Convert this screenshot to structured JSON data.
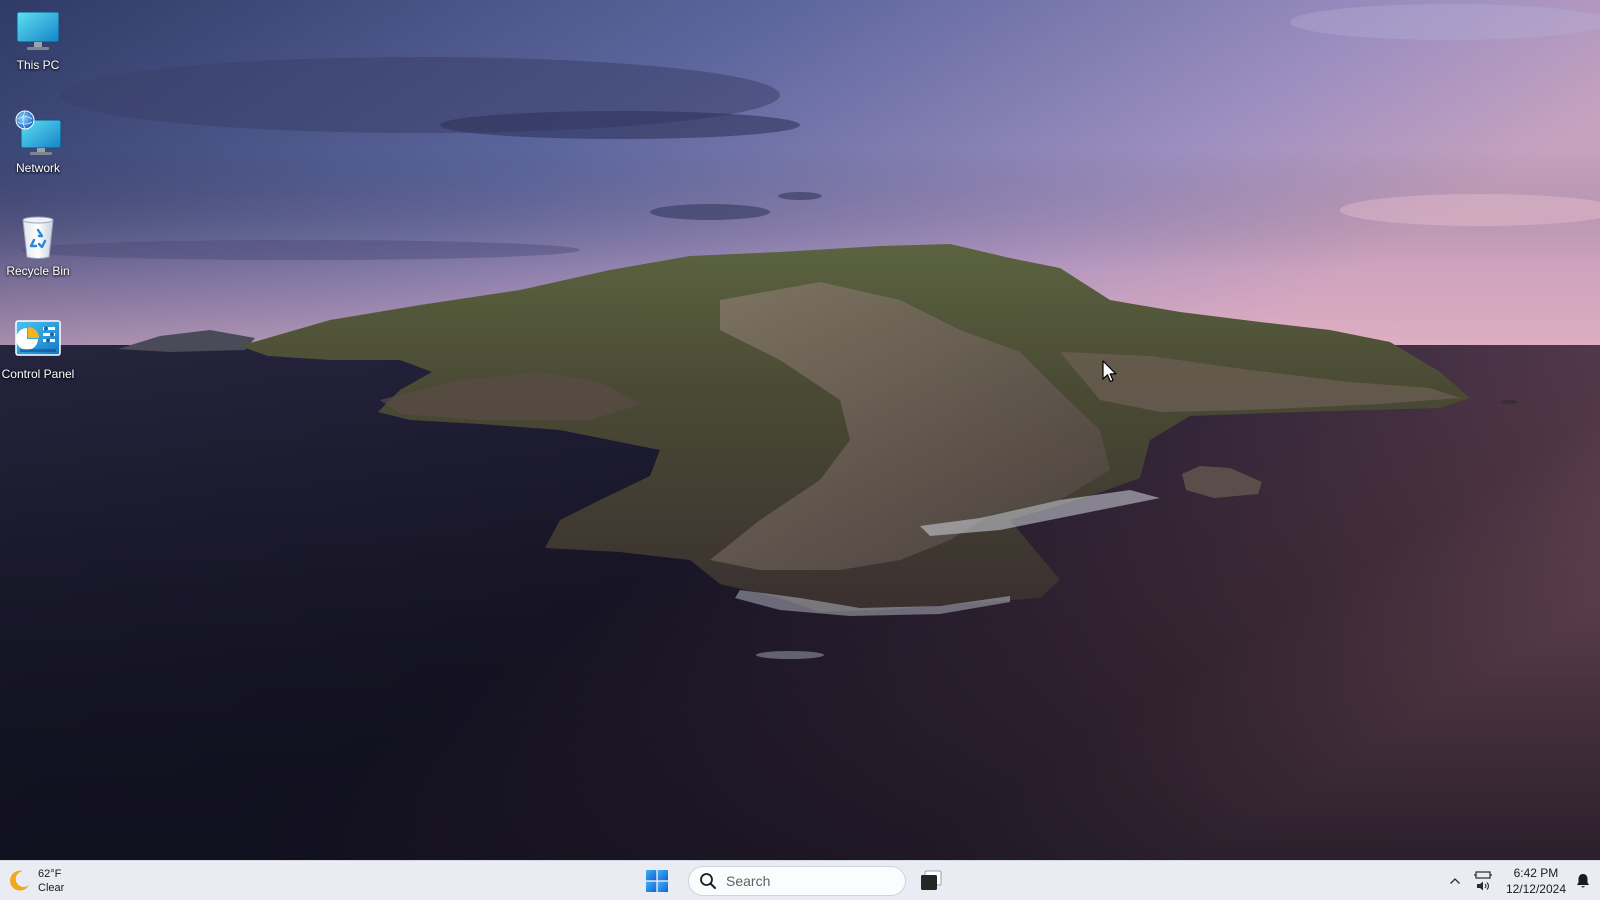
{
  "desktop": {
    "icons": [
      {
        "label": "This PC",
        "icon": "monitor-icon"
      },
      {
        "label": "Network",
        "icon": "network-globe-icon"
      },
      {
        "label": "Recycle Bin",
        "icon": "recycle-bin-icon"
      },
      {
        "label": "Control Panel",
        "icon": "control-panel-icon"
      }
    ]
  },
  "taskbar": {
    "weather": {
      "temperature": "62°F",
      "condition": "Clear",
      "icon": "moon-icon"
    },
    "search": {
      "placeholder": "Search"
    },
    "tray": {
      "time": "6:42 PM",
      "date": "12/12/2024",
      "icons": [
        "chevron-up-icon",
        "network-icon",
        "speaker-icon",
        "bell-icon"
      ]
    }
  },
  "colors": {
    "taskbar_bg": "#e9edf3",
    "start_blue": "#1f7be0",
    "label_text": "#ffffff"
  }
}
